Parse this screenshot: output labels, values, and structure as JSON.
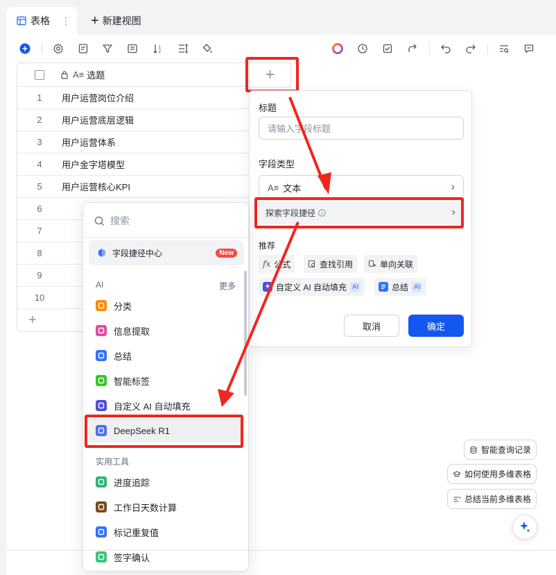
{
  "tabs": {
    "active_label": "表格",
    "more_icon": "⋮",
    "new_view_label": "新建视图"
  },
  "toolbar": {
    "left_icons": [
      "add-icon",
      "settings-icon",
      "form-icon",
      "filter-icon",
      "list-icon",
      "sort-icon",
      "row-height-icon",
      "fill-color-icon"
    ],
    "right_icons": [
      "ai-ring-icon",
      "history-icon",
      "check-icon",
      "share-icon",
      "undo-icon",
      "redo-icon",
      "find-icon",
      "comment-icon"
    ]
  },
  "grid": {
    "header_label": "选题",
    "rows": [
      {
        "num": "1",
        "text": "用户运营岗位介绍"
      },
      {
        "num": "2",
        "text": "用户运营底层逻辑"
      },
      {
        "num": "3",
        "text": "用户运营体系"
      },
      {
        "num": "4",
        "text": "用户金字塔模型"
      },
      {
        "num": "5",
        "text": "用户运营核心KPI"
      },
      {
        "num": "6",
        "text": ""
      },
      {
        "num": "7",
        "text": ""
      },
      {
        "num": "8",
        "text": ""
      },
      {
        "num": "9",
        "text": ""
      },
      {
        "num": "10",
        "text": ""
      }
    ],
    "add_row_symbol": "+",
    "add_col_symbol": "+"
  },
  "field_panel": {
    "title_label": "标题",
    "title_placeholder": "请输入字段标题",
    "type_label": "字段类型",
    "type_value": "文本",
    "explore_label": "探索字段捷径",
    "recommend_label": "推荐",
    "recommend": [
      "公式",
      "查找引用",
      "单向关联"
    ],
    "ai_recommend": [
      "自定义 AI 自动填充",
      "总结"
    ],
    "ai_badge": "AI",
    "cancel_label": "取消",
    "ok_label": "确定"
  },
  "dropdown": {
    "search_placeholder": "搜索",
    "center_label": "字段捷径中心",
    "new_badge": "New",
    "ai_group": "AI",
    "more_label": "更多",
    "ai_items": [
      {
        "label": "分类",
        "color": "#ff8a00"
      },
      {
        "label": "信息提取",
        "color": "#e24aa4"
      },
      {
        "label": "总结",
        "color": "#3370ff"
      },
      {
        "label": "智能标签",
        "color": "#34c724"
      },
      {
        "label": "自定义 AI 自动填充",
        "color": "#4e4ed8"
      },
      {
        "label": "DeepSeek R1",
        "color": "#4d6bfe"
      }
    ],
    "tools_group": "实用工具",
    "tool_items": [
      {
        "label": "进度追踪",
        "color": "#2bb673"
      },
      {
        "label": "工作日天数计算",
        "color": "#7a4a1e"
      },
      {
        "label": "标记重复值",
        "color": "#3370ff"
      },
      {
        "label": "签字确认",
        "color": "#34c77b"
      }
    ]
  },
  "side_actions": [
    "智能查询记录",
    "如何使用多维表格",
    "总结当前多维表格"
  ],
  "colors": {
    "primary": "#1456f0",
    "highlight": "#f0261f"
  }
}
